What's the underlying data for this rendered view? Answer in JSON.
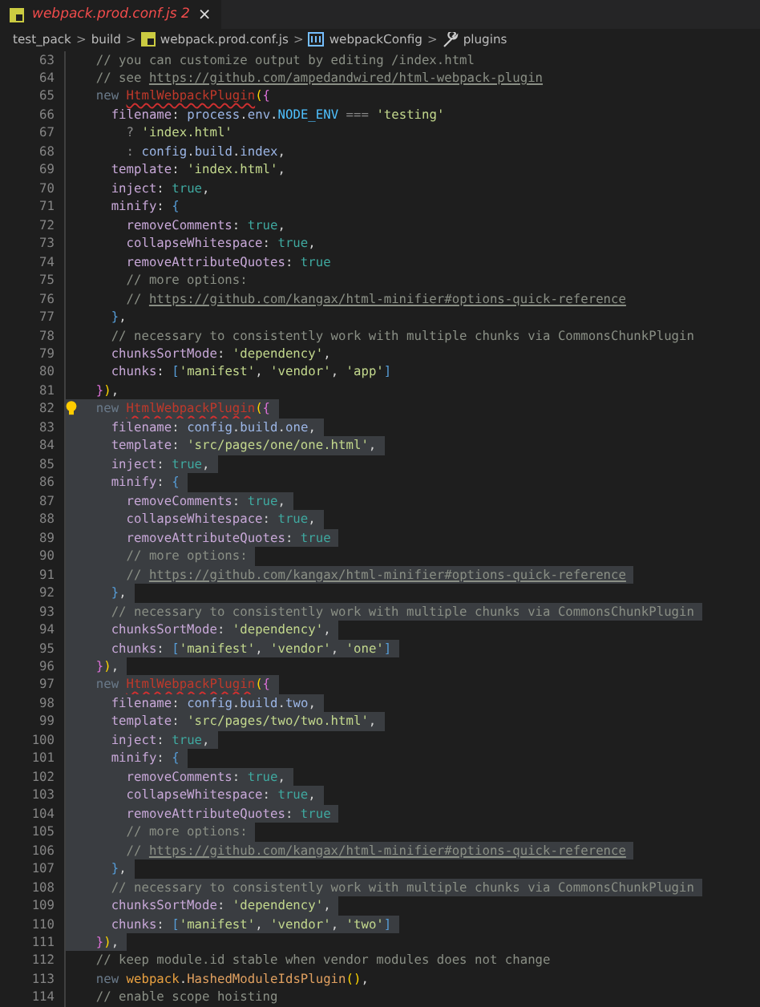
{
  "tabs": [
    {
      "label": "webpack.prod.conf.js 2",
      "selected": true,
      "close": "×"
    }
  ],
  "breadcrumbs": [
    {
      "kind": "folder",
      "label": "test_pack"
    },
    {
      "kind": "folder",
      "label": "build"
    },
    {
      "kind": "file",
      "label": "webpack.prod.conf.js"
    },
    {
      "kind": "module",
      "label": "webpackConfig"
    },
    {
      "kind": "property",
      "label": "plugins"
    }
  ],
  "breadcrumb_separator": ">",
  "lines": [
    {
      "n": "63",
      "selected": false,
      "lightbulb": false,
      "tokens": [
        {
          "kind": "comment",
          "text": "    // you can customize output by editing /index.html"
        }
      ]
    },
    {
      "n": "64",
      "selected": false,
      "lightbulb": false,
      "tokens": [
        {
          "kind": "comment",
          "text": "    // see "
        },
        {
          "kind": "link",
          "text": "https://github.com/ampedandwired/html-webpack-plugin"
        }
      ]
    },
    {
      "n": "65",
      "selected": false,
      "lightbulb": false,
      "tokens": [
        {
          "kind": "keyword",
          "text": "    new "
        },
        {
          "kind": "error",
          "text": "HtmlWebpackPlugin"
        },
        {
          "kind": "paren",
          "text": "("
        },
        {
          "kind": "brace",
          "text": "{"
        }
      ]
    },
    {
      "n": "66",
      "selected": false,
      "lightbulb": false,
      "tokens": [
        {
          "kind": "property",
          "text": "      filename"
        },
        {
          "kind": "plain",
          "text": ": "
        },
        {
          "kind": "variable",
          "text": "process"
        },
        {
          "kind": "plain",
          "text": "."
        },
        {
          "kind": "variable",
          "text": "env"
        },
        {
          "kind": "plain",
          "text": "."
        },
        {
          "kind": "constant",
          "text": "NODE_ENV"
        },
        {
          "kind": "operator",
          "text": " === "
        },
        {
          "kind": "string",
          "text": "'testing'"
        }
      ]
    },
    {
      "n": "67",
      "selected": false,
      "lightbulb": false,
      "tokens": [
        {
          "kind": "operator",
          "text": "        ? "
        },
        {
          "kind": "string",
          "text": "'index.html'"
        }
      ]
    },
    {
      "n": "68",
      "selected": false,
      "lightbulb": false,
      "tokens": [
        {
          "kind": "operator",
          "text": "        : "
        },
        {
          "kind": "variable",
          "text": "config"
        },
        {
          "kind": "plain",
          "text": "."
        },
        {
          "kind": "variable",
          "text": "build"
        },
        {
          "kind": "plain",
          "text": "."
        },
        {
          "kind": "variable",
          "text": "index"
        },
        {
          "kind": "plain",
          "text": ","
        }
      ]
    },
    {
      "n": "69",
      "selected": false,
      "lightbulb": false,
      "tokens": [
        {
          "kind": "property",
          "text": "      template"
        },
        {
          "kind": "plain",
          "text": ": "
        },
        {
          "kind": "string",
          "text": "'index.html'"
        },
        {
          "kind": "plain",
          "text": ","
        }
      ]
    },
    {
      "n": "70",
      "selected": false,
      "lightbulb": false,
      "tokens": [
        {
          "kind": "property",
          "text": "      inject"
        },
        {
          "kind": "plain",
          "text": ": "
        },
        {
          "kind": "boolean",
          "text": "true"
        },
        {
          "kind": "plain",
          "text": ","
        }
      ]
    },
    {
      "n": "71",
      "selected": false,
      "lightbulb": false,
      "tokens": [
        {
          "kind": "property",
          "text": "      minify"
        },
        {
          "kind": "plain",
          "text": ": "
        },
        {
          "kind": "bracket",
          "text": "{"
        }
      ]
    },
    {
      "n": "72",
      "selected": false,
      "lightbulb": false,
      "tokens": [
        {
          "kind": "property",
          "text": "        removeComments"
        },
        {
          "kind": "plain",
          "text": ": "
        },
        {
          "kind": "boolean",
          "text": "true"
        },
        {
          "kind": "plain",
          "text": ","
        }
      ]
    },
    {
      "n": "73",
      "selected": false,
      "lightbulb": false,
      "tokens": [
        {
          "kind": "property",
          "text": "        collapseWhitespace"
        },
        {
          "kind": "plain",
          "text": ": "
        },
        {
          "kind": "boolean",
          "text": "true"
        },
        {
          "kind": "plain",
          "text": ","
        }
      ]
    },
    {
      "n": "74",
      "selected": false,
      "lightbulb": false,
      "tokens": [
        {
          "kind": "property",
          "text": "        removeAttributeQuotes"
        },
        {
          "kind": "plain",
          "text": ": "
        },
        {
          "kind": "boolean",
          "text": "true"
        }
      ]
    },
    {
      "n": "75",
      "selected": false,
      "lightbulb": false,
      "tokens": [
        {
          "kind": "comment",
          "text": "        // more options:"
        }
      ]
    },
    {
      "n": "76",
      "selected": false,
      "lightbulb": false,
      "tokens": [
        {
          "kind": "comment",
          "text": "        // "
        },
        {
          "kind": "link",
          "text": "https://github.com/kangax/html-minifier#options-quick-reference"
        }
      ]
    },
    {
      "n": "77",
      "selected": false,
      "lightbulb": false,
      "tokens": [
        {
          "kind": "bracket",
          "text": "      }"
        },
        {
          "kind": "plain",
          "text": ","
        }
      ]
    },
    {
      "n": "78",
      "selected": false,
      "lightbulb": false,
      "tokens": [
        {
          "kind": "comment",
          "text": "      // necessary to consistently work with multiple chunks via CommonsChunkPlugin"
        }
      ]
    },
    {
      "n": "79",
      "selected": false,
      "lightbulb": false,
      "tokens": [
        {
          "kind": "property",
          "text": "      chunksSortMode"
        },
        {
          "kind": "plain",
          "text": ": "
        },
        {
          "kind": "string",
          "text": "'dependency'"
        },
        {
          "kind": "plain",
          "text": ","
        }
      ]
    },
    {
      "n": "80",
      "selected": false,
      "lightbulb": false,
      "tokens": [
        {
          "kind": "property",
          "text": "      chunks"
        },
        {
          "kind": "plain",
          "text": ": "
        },
        {
          "kind": "bracket",
          "text": "["
        },
        {
          "kind": "string",
          "text": "'manifest'"
        },
        {
          "kind": "plain",
          "text": ", "
        },
        {
          "kind": "string",
          "text": "'vendor'"
        },
        {
          "kind": "plain",
          "text": ", "
        },
        {
          "kind": "string",
          "text": "'app'"
        },
        {
          "kind": "bracket",
          "text": "]"
        }
      ]
    },
    {
      "n": "81",
      "selected": false,
      "lightbulb": false,
      "tokens": [
        {
          "kind": "brace",
          "text": "    }"
        },
        {
          "kind": "paren",
          "text": ")"
        },
        {
          "kind": "plain",
          "text": ","
        }
      ]
    },
    {
      "n": "82",
      "selected": true,
      "lightbulb": true,
      "tokens": [
        {
          "kind": "keyword",
          "text": "    new "
        },
        {
          "kind": "error",
          "text": "HtmlWebpackPlugin"
        },
        {
          "kind": "paren",
          "text": "("
        },
        {
          "kind": "brace",
          "text": "{"
        }
      ]
    },
    {
      "n": "83",
      "selected": true,
      "lightbulb": false,
      "tokens": [
        {
          "kind": "property",
          "text": "      filename"
        },
        {
          "kind": "plain",
          "text": ": "
        },
        {
          "kind": "variable",
          "text": "config"
        },
        {
          "kind": "plain",
          "text": "."
        },
        {
          "kind": "variable",
          "text": "build"
        },
        {
          "kind": "plain",
          "text": "."
        },
        {
          "kind": "variable",
          "text": "one"
        },
        {
          "kind": "plain",
          "text": ","
        }
      ]
    },
    {
      "n": "84",
      "selected": true,
      "lightbulb": false,
      "tokens": [
        {
          "kind": "property",
          "text": "      template"
        },
        {
          "kind": "plain",
          "text": ": "
        },
        {
          "kind": "string",
          "text": "'src/pages/one/one.html'"
        },
        {
          "kind": "plain",
          "text": ","
        }
      ]
    },
    {
      "n": "85",
      "selected": true,
      "lightbulb": false,
      "tokens": [
        {
          "kind": "property",
          "text": "      inject"
        },
        {
          "kind": "plain",
          "text": ": "
        },
        {
          "kind": "boolean",
          "text": "true"
        },
        {
          "kind": "plain",
          "text": ","
        }
      ]
    },
    {
      "n": "86",
      "selected": true,
      "lightbulb": false,
      "tokens": [
        {
          "kind": "property",
          "text": "      minify"
        },
        {
          "kind": "plain",
          "text": ": "
        },
        {
          "kind": "bracket",
          "text": "{"
        }
      ]
    },
    {
      "n": "87",
      "selected": true,
      "lightbulb": false,
      "tokens": [
        {
          "kind": "property",
          "text": "        removeComments"
        },
        {
          "kind": "plain",
          "text": ": "
        },
        {
          "kind": "boolean",
          "text": "true"
        },
        {
          "kind": "plain",
          "text": ","
        }
      ]
    },
    {
      "n": "88",
      "selected": true,
      "lightbulb": false,
      "tokens": [
        {
          "kind": "property",
          "text": "        collapseWhitespace"
        },
        {
          "kind": "plain",
          "text": ": "
        },
        {
          "kind": "boolean",
          "text": "true"
        },
        {
          "kind": "plain",
          "text": ","
        }
      ]
    },
    {
      "n": "89",
      "selected": true,
      "lightbulb": false,
      "tokens": [
        {
          "kind": "property",
          "text": "        removeAttributeQuotes"
        },
        {
          "kind": "plain",
          "text": ": "
        },
        {
          "kind": "boolean",
          "text": "true"
        }
      ]
    },
    {
      "n": "90",
      "selected": true,
      "lightbulb": false,
      "tokens": [
        {
          "kind": "comment",
          "text": "        // more options:"
        }
      ]
    },
    {
      "n": "91",
      "selected": true,
      "lightbulb": false,
      "tokens": [
        {
          "kind": "comment",
          "text": "        // "
        },
        {
          "kind": "link",
          "text": "https://github.com/kangax/html-minifier#options-quick-reference"
        }
      ]
    },
    {
      "n": "92",
      "selected": true,
      "lightbulb": false,
      "tokens": [
        {
          "kind": "bracket",
          "text": "      }"
        },
        {
          "kind": "plain",
          "text": ","
        }
      ]
    },
    {
      "n": "93",
      "selected": true,
      "lightbulb": false,
      "tokens": [
        {
          "kind": "comment",
          "text": "      // necessary to consistently work with multiple chunks via CommonsChunkPlugin"
        }
      ]
    },
    {
      "n": "94",
      "selected": true,
      "lightbulb": false,
      "tokens": [
        {
          "kind": "property",
          "text": "      chunksSortMode"
        },
        {
          "kind": "plain",
          "text": ": "
        },
        {
          "kind": "string",
          "text": "'dependency'"
        },
        {
          "kind": "plain",
          "text": ","
        }
      ]
    },
    {
      "n": "95",
      "selected": true,
      "lightbulb": false,
      "tokens": [
        {
          "kind": "property",
          "text": "      chunks"
        },
        {
          "kind": "plain",
          "text": ": "
        },
        {
          "kind": "bracket",
          "text": "["
        },
        {
          "kind": "string",
          "text": "'manifest'"
        },
        {
          "kind": "plain",
          "text": ", "
        },
        {
          "kind": "string",
          "text": "'vendor'"
        },
        {
          "kind": "plain",
          "text": ", "
        },
        {
          "kind": "string",
          "text": "'one'"
        },
        {
          "kind": "bracket",
          "text": "]"
        }
      ]
    },
    {
      "n": "96",
      "selected": true,
      "lightbulb": false,
      "tokens": [
        {
          "kind": "brace",
          "text": "    }"
        },
        {
          "kind": "paren",
          "text": ")"
        },
        {
          "kind": "plain",
          "text": ","
        }
      ]
    },
    {
      "n": "97",
      "selected": true,
      "lightbulb": false,
      "tokens": [
        {
          "kind": "keyword",
          "text": "    new "
        },
        {
          "kind": "error",
          "text": "HtmlWebpackPlugin"
        },
        {
          "kind": "paren",
          "text": "("
        },
        {
          "kind": "brace",
          "text": "{"
        }
      ]
    },
    {
      "n": "98",
      "selected": true,
      "lightbulb": false,
      "tokens": [
        {
          "kind": "property",
          "text": "      filename"
        },
        {
          "kind": "plain",
          "text": ": "
        },
        {
          "kind": "variable",
          "text": "config"
        },
        {
          "kind": "plain",
          "text": "."
        },
        {
          "kind": "variable",
          "text": "build"
        },
        {
          "kind": "plain",
          "text": "."
        },
        {
          "kind": "variable",
          "text": "two"
        },
        {
          "kind": "plain",
          "text": ","
        }
      ]
    },
    {
      "n": "99",
      "selected": true,
      "lightbulb": false,
      "tokens": [
        {
          "kind": "property",
          "text": "      template"
        },
        {
          "kind": "plain",
          "text": ": "
        },
        {
          "kind": "string",
          "text": "'src/pages/two/two.html'"
        },
        {
          "kind": "plain",
          "text": ","
        }
      ]
    },
    {
      "n": "100",
      "selected": true,
      "lightbulb": false,
      "tokens": [
        {
          "kind": "property",
          "text": "      inject"
        },
        {
          "kind": "plain",
          "text": ": "
        },
        {
          "kind": "boolean",
          "text": "true"
        },
        {
          "kind": "plain",
          "text": ","
        }
      ]
    },
    {
      "n": "101",
      "selected": true,
      "lightbulb": false,
      "tokens": [
        {
          "kind": "property",
          "text": "      minify"
        },
        {
          "kind": "plain",
          "text": ": "
        },
        {
          "kind": "bracket",
          "text": "{"
        }
      ]
    },
    {
      "n": "102",
      "selected": true,
      "lightbulb": false,
      "tokens": [
        {
          "kind": "property",
          "text": "        removeComments"
        },
        {
          "kind": "plain",
          "text": ": "
        },
        {
          "kind": "boolean",
          "text": "true"
        },
        {
          "kind": "plain",
          "text": ","
        }
      ]
    },
    {
      "n": "103",
      "selected": true,
      "lightbulb": false,
      "tokens": [
        {
          "kind": "property",
          "text": "        collapseWhitespace"
        },
        {
          "kind": "plain",
          "text": ": "
        },
        {
          "kind": "boolean",
          "text": "true"
        },
        {
          "kind": "plain",
          "text": ","
        }
      ]
    },
    {
      "n": "104",
      "selected": true,
      "lightbulb": false,
      "tokens": [
        {
          "kind": "property",
          "text": "        removeAttributeQuotes"
        },
        {
          "kind": "plain",
          "text": ": "
        },
        {
          "kind": "boolean",
          "text": "true"
        }
      ]
    },
    {
      "n": "105",
      "selected": true,
      "lightbulb": false,
      "tokens": [
        {
          "kind": "comment",
          "text": "        // more options:"
        }
      ]
    },
    {
      "n": "106",
      "selected": true,
      "lightbulb": false,
      "tokens": [
        {
          "kind": "comment",
          "text": "        // "
        },
        {
          "kind": "link",
          "text": "https://github.com/kangax/html-minifier#options-quick-reference"
        }
      ]
    },
    {
      "n": "107",
      "selected": true,
      "lightbulb": false,
      "tokens": [
        {
          "kind": "bracket",
          "text": "      }"
        },
        {
          "kind": "plain",
          "text": ","
        }
      ]
    },
    {
      "n": "108",
      "selected": true,
      "lightbulb": false,
      "tokens": [
        {
          "kind": "comment",
          "text": "      // necessary to consistently work with multiple chunks via CommonsChunkPlugin"
        }
      ]
    },
    {
      "n": "109",
      "selected": true,
      "lightbulb": false,
      "tokens": [
        {
          "kind": "property",
          "text": "      chunksSortMode"
        },
        {
          "kind": "plain",
          "text": ": "
        },
        {
          "kind": "string",
          "text": "'dependency'"
        },
        {
          "kind": "plain",
          "text": ","
        }
      ]
    },
    {
      "n": "110",
      "selected": true,
      "lightbulb": false,
      "tokens": [
        {
          "kind": "property",
          "text": "      chunks"
        },
        {
          "kind": "plain",
          "text": ": "
        },
        {
          "kind": "bracket",
          "text": "["
        },
        {
          "kind": "string",
          "text": "'manifest'"
        },
        {
          "kind": "plain",
          "text": ", "
        },
        {
          "kind": "string",
          "text": "'vendor'"
        },
        {
          "kind": "plain",
          "text": ", "
        },
        {
          "kind": "string",
          "text": "'two'"
        },
        {
          "kind": "bracket",
          "text": "]"
        }
      ]
    },
    {
      "n": "111",
      "selected": true,
      "lightbulb": false,
      "tokens": [
        {
          "kind": "brace",
          "text": "    }"
        },
        {
          "kind": "paren",
          "text": ")"
        },
        {
          "kind": "plain",
          "text": ","
        }
      ]
    },
    {
      "n": "112",
      "selected": false,
      "lightbulb": false,
      "tokens": [
        {
          "kind": "comment",
          "text": "    // keep module.id stable when vendor modules does not change"
        }
      ]
    },
    {
      "n": "113",
      "selected": false,
      "lightbulb": false,
      "tokens": [
        {
          "kind": "keyword",
          "text": "    new "
        },
        {
          "kind": "namespace",
          "text": "webpack"
        },
        {
          "kind": "plain",
          "text": "."
        },
        {
          "kind": "class",
          "text": "HashedModuleIdsPlugin"
        },
        {
          "kind": "paren",
          "text": "()"
        },
        {
          "kind": "plain",
          "text": ","
        }
      ]
    },
    {
      "n": "114",
      "selected": false,
      "lightbulb": false,
      "tokens": [
        {
          "kind": "comment",
          "text": "    // enable scope hoisting"
        }
      ]
    }
  ]
}
